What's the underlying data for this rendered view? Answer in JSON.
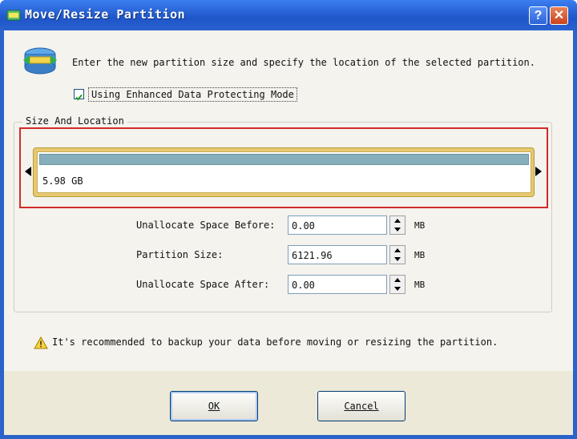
{
  "window": {
    "title": "Move/Resize Partition",
    "help_label": "?",
    "close_label": "✕"
  },
  "intro": {
    "text": "Enter the new partition size and specify the location of the selected partition."
  },
  "protect_mode": {
    "checked": true,
    "label": "Using Enhanced Data Protecting Mode"
  },
  "size_location": {
    "group_label": "Size And Location",
    "partition_size_text": "5.98 GB"
  },
  "fields": [
    {
      "label": "Unallocate Space Before:",
      "value": "0.00",
      "unit": "MB"
    },
    {
      "label": "Partition Size:",
      "value": "6121.96",
      "unit": "MB"
    },
    {
      "label": "Unallocate Space After:",
      "value": "0.00",
      "unit": "MB"
    }
  ],
  "warning": {
    "text": "It's recommended to backup your data before moving or resizing the partition."
  },
  "buttons": {
    "ok": "OK",
    "cancel": "Cancel"
  },
  "colors": {
    "titlebar": "#2a62d0",
    "highlight_border": "#d22a2a",
    "partition_fill": "#86aebb",
    "partition_frame": "#e6c970"
  }
}
